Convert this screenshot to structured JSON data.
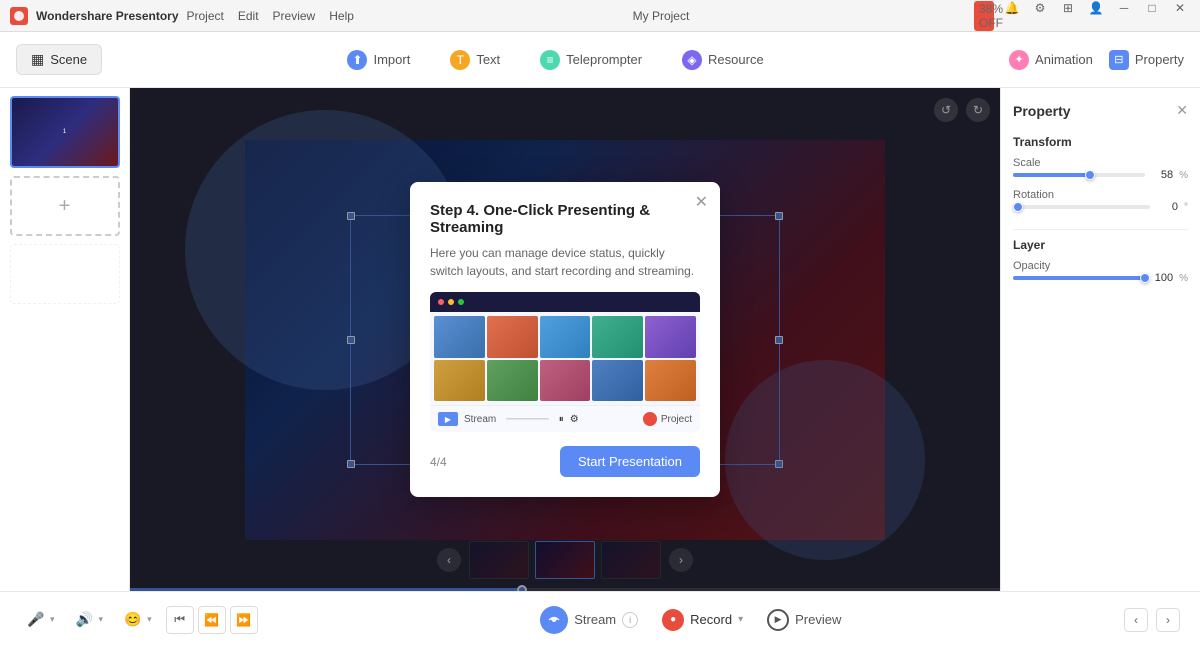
{
  "app": {
    "name": "Wondershare Presentory",
    "project_name": "My Project",
    "off_badge": "38% OFF"
  },
  "menu": {
    "items": [
      "Project",
      "Edit",
      "Preview",
      "Help"
    ]
  },
  "toolbar": {
    "scene_label": "Scene",
    "import_label": "Import",
    "text_label": "Text",
    "teleprompter_label": "Teleprompter",
    "resource_label": "Resource",
    "animation_label": "Animation",
    "property_label": "Property"
  },
  "property_panel": {
    "title": "Property",
    "transform_label": "Transform",
    "scale_label": "Scale",
    "scale_value": "58",
    "scale_unit": "%",
    "rotation_label": "Rotation",
    "rotation_value": "0",
    "rotation_unit": "°",
    "layer_label": "Layer",
    "opacity_label": "Opacity",
    "opacity_value": "100",
    "opacity_unit": "%"
  },
  "modal": {
    "title": "Step 4. One-Click Presenting & Streaming",
    "description": "Here you can manage device status, quickly switch layouts, and start recording and streaming.",
    "page_indicator": "4/4",
    "start_button": "Start Presentation",
    "stream_label": "Stream",
    "record_label": "Project"
  },
  "bottom_bar": {
    "stream_label": "Stream",
    "record_label": "Record",
    "preview_label": "Preview"
  },
  "canvas": {
    "slide_number": "1"
  }
}
